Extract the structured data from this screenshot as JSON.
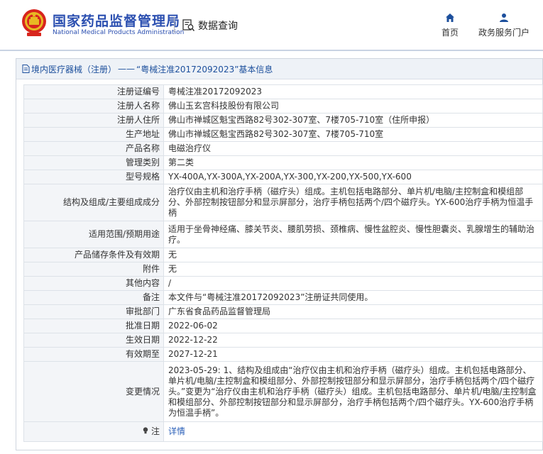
{
  "header": {
    "brand_cn": "国家药品监督管理局",
    "brand_en": "National Medical Products Administration",
    "query_label": "数据查询",
    "nav": [
      {
        "label": "首页",
        "icon": "home-icon"
      },
      {
        "label": "政务服务门户",
        "icon": "user-icon"
      }
    ]
  },
  "breadcrumb": {
    "parent": "境内医疗器械（注册）",
    "separator": "——",
    "title": "“粤械注准20172092023”基本信息"
  },
  "rows": [
    {
      "label": "注册证编号",
      "value": "粤械注准20172092023"
    },
    {
      "label": "注册人名称",
      "value": "佛山玉玄宫科技股份有限公司"
    },
    {
      "label": "注册人住所",
      "value": "佛山市禅城区魁宝西路82号302-307室、7楼705-710室（住所申报）"
    },
    {
      "label": "生产地址",
      "value": "佛山市禅城区魁宝西路82号302-307室、7楼705-710室"
    },
    {
      "label": "产品名称",
      "value": "电磁治疗仪"
    },
    {
      "label": "管理类别",
      "value": "第二类"
    },
    {
      "label": "型号规格",
      "value": "YX-400A,YX-300A,YX-200A,YX-300,YX-200,YX-500,YX-600"
    },
    {
      "label": "结构及组成/主要组成成分",
      "value": "治疗仪由主机和治疗手柄（磁疗头）组成。主机包括电路部分、单片机/电脑/主控制盒和模组部分、外部控制按钮部分和显示屏部分，治疗手柄包括两个/四个磁疗头。YX-600治疗手柄为恒温手柄"
    },
    {
      "label": "适用范围/预期用途",
      "value": "适用于坐骨神经痛、膝关节炎、腰肌劳损、颈椎病、慢性盆腔炎、慢性胆囊炎、乳腺增生的辅助治疗。"
    },
    {
      "label": "产品储存条件及有效期",
      "value": "无"
    },
    {
      "label": "附件",
      "value": "无"
    },
    {
      "label": "其他内容",
      "value": "/"
    },
    {
      "label": "备注",
      "value": "本文件与“粤械注准20172092023”注册证共同使用。"
    },
    {
      "label": "审批部门",
      "value": "广东省食品药品监督管理局"
    },
    {
      "label": "批准日期",
      "value": "2022-06-02"
    },
    {
      "label": "生效日期",
      "value": "2022-12-22"
    },
    {
      "label": "有效期至",
      "value": "2027-12-21"
    },
    {
      "label": "变更情况",
      "value": "2023-05-29: 1、结构及组成由“治疗仪由主机和治疗手柄（磁疗头）组成。主机包括电路部分、单片机/电脑/主控制盒和模组部分、外部控制按钮部分和显示屏部分，治疗手柄包括两个/四个磁疗头。”变更为“治疗仪由主机和治疗手柄（磁疗头）组成。主机包括电路部分、单片机/电脑/主控制盒和模组部分、外部控制按钮部分和显示屏部分，治疗手柄包括两个/四个磁疗头。YX-600治疗手柄为恒温手柄”。"
    }
  ],
  "footer_row": {
    "label": "注",
    "label_icon": "bulb-icon",
    "link": "详情"
  }
}
